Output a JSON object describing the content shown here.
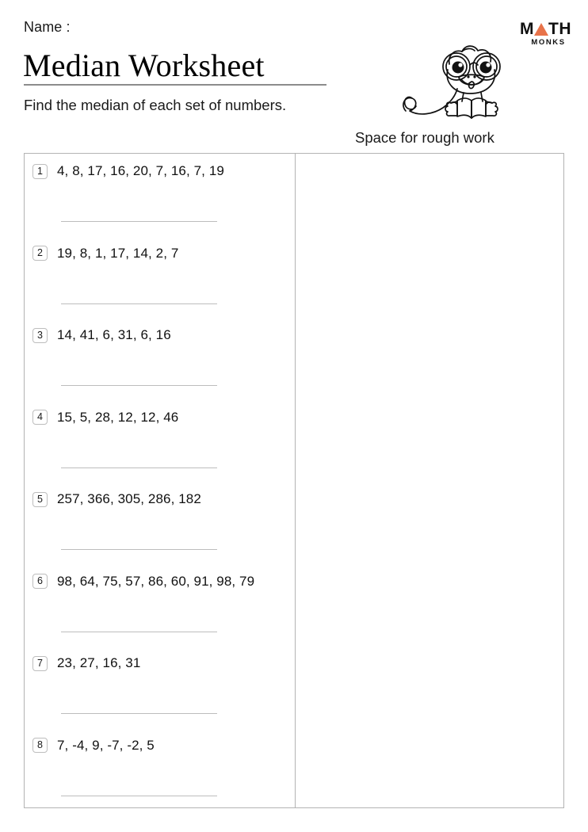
{
  "header": {
    "name_label": "Name :",
    "title": "Median Worksheet",
    "instruction": "Find the median of each set of numbers.",
    "rough_work_label": "Space for rough work"
  },
  "logo": {
    "wordmark_pre": "M",
    "wordmark_post": "TH",
    "subtext": "MONKS",
    "triangle_icon": "triangle-icon",
    "accent_color": "#e8734a",
    "text_color": "#111111"
  },
  "mascot": {
    "icon": "monkey-reading-book-icon",
    "description": "line-art monkey with round glasses reading an open book, long curly tail"
  },
  "table": {
    "border_color": "#b3b3b3",
    "columns": [
      "questions",
      "rough-work"
    ],
    "questions": [
      {
        "number": "1",
        "text": "4, 8, 17, 16, 20, 7, 16, 7, 19"
      },
      {
        "number": "2",
        "text": "19, 8, 1, 17, 14, 2, 7"
      },
      {
        "number": "3",
        "text": "14, 41, 6, 31, 6, 16"
      },
      {
        "number": "4",
        "text": "15, 5, 28, 12, 12, 46"
      },
      {
        "number": "5",
        "text": "257, 366, 305, 286, 182"
      },
      {
        "number": "6",
        "text": "98, 64, 75, 57, 86, 60, 91, 98, 79"
      },
      {
        "number": "7",
        "text": "23, 27, 16, 31"
      },
      {
        "number": "8",
        "text": "7, -4, 9, -7, -2, 5"
      }
    ]
  }
}
